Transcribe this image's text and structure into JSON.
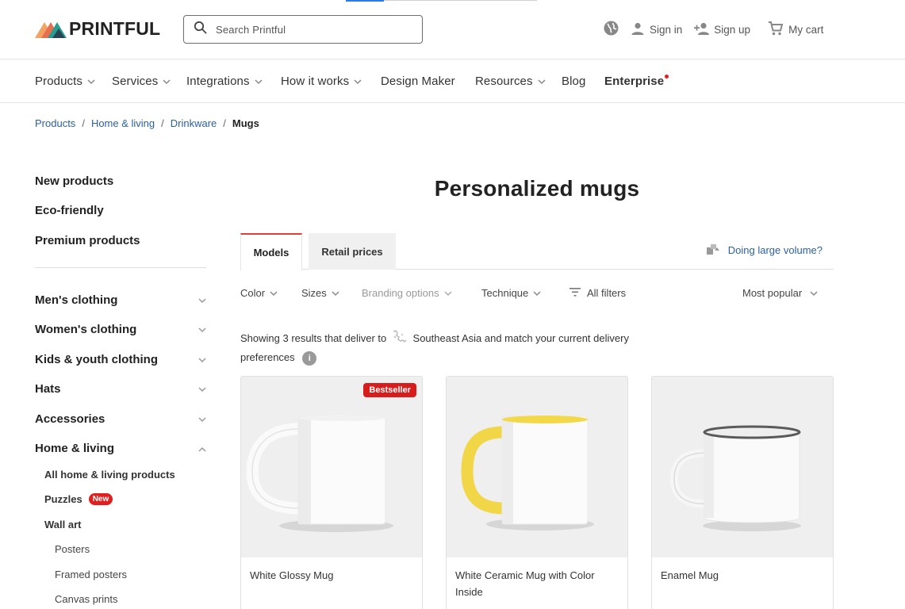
{
  "header": {
    "logo_text": "PRINTFUL",
    "search_placeholder": "Search Printful",
    "sign_in": "Sign in",
    "sign_up": "Sign up",
    "cart": "My cart"
  },
  "nav": {
    "items": [
      {
        "label": "Products",
        "dropdown": true
      },
      {
        "label": "Services",
        "dropdown": true
      },
      {
        "label": "Integrations",
        "dropdown": true
      },
      {
        "label": "How it works",
        "dropdown": true
      },
      {
        "label": "Design Maker",
        "dropdown": false
      },
      {
        "label": "Resources",
        "dropdown": true
      },
      {
        "label": "Blog",
        "dropdown": false
      },
      {
        "label": "Enterprise",
        "dropdown": false
      }
    ]
  },
  "breadcrumb": [
    "Products",
    "Home & living",
    "Drinkware",
    "Mugs"
  ],
  "sidebar": {
    "top_links": [
      "New products",
      "Eco-friendly",
      "Premium products"
    ],
    "categories": [
      "Men's clothing",
      "Women's clothing",
      "Kids & youth clothing",
      "Hats",
      "Accessories",
      "Home & living"
    ],
    "home_living_items": [
      "All home & living products",
      "Puzzles",
      "Wall art"
    ],
    "new_badge": "New",
    "wall_art_items": [
      "Posters",
      "Framed posters",
      "Canvas prints"
    ]
  },
  "main": {
    "title": "Personalized mugs",
    "tabs": [
      "Models",
      "Retail prices"
    ],
    "volume_link": "Doing large volume?",
    "filters": [
      "Color",
      "Sizes",
      "Branding options",
      "Technique",
      "All filters"
    ],
    "sort": "Most popular",
    "results_text": "Showing 3 results that deliver to",
    "results_region": "Southeast Asia and match your current delivery preferences",
    "info_icon": "i"
  },
  "products": [
    {
      "name": "White Glossy Mug",
      "badge": "Bestseller"
    },
    {
      "name": "White Ceramic Mug with Color Inside",
      "badge": ""
    },
    {
      "name": "Enamel Mug",
      "badge": ""
    }
  ],
  "colors": {
    "accent": "#e0403a",
    "link": "#2b5fa8",
    "badge_red": "#d81c1c",
    "mug_yellow": "#f3d94a"
  }
}
